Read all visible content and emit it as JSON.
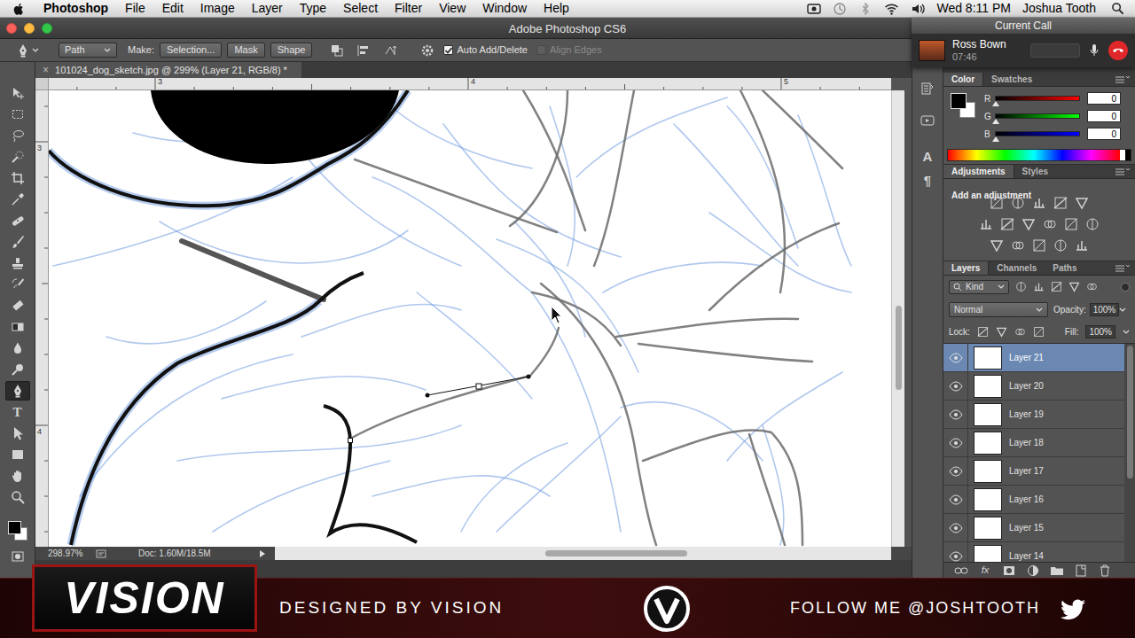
{
  "menubar": {
    "app": "Photoshop",
    "items": [
      "File",
      "Edit",
      "Image",
      "Layer",
      "Type",
      "Select",
      "Filter",
      "View",
      "Window",
      "Help"
    ],
    "clock": "Wed 8:11 PM",
    "user": "Joshua Tooth"
  },
  "window": {
    "title": "Adobe Photoshop CS6"
  },
  "call": {
    "title": "Current Call",
    "name": "Ross Bown",
    "time": "07:46"
  },
  "options_bar": {
    "mode": "Path",
    "make_label": "Make:",
    "buttons": [
      "Selection...",
      "Mask",
      "Shape"
    ],
    "checkboxes": [
      {
        "label": "Auto Add/Delete",
        "checked": true,
        "disabled": false
      },
      {
        "label": "Align Edges",
        "checked": false,
        "disabled": true
      }
    ]
  },
  "toolbox": {
    "tools": [
      {
        "kind": "move",
        "selected": false
      },
      {
        "kind": "marquee",
        "selected": false
      },
      {
        "kind": "lasso",
        "selected": false
      },
      {
        "kind": "quickselect",
        "selected": false
      },
      {
        "kind": "crop",
        "selected": false
      },
      {
        "kind": "eyedropper",
        "selected": false
      },
      {
        "kind": "healing",
        "selected": false
      },
      {
        "kind": "brush",
        "selected": false
      },
      {
        "kind": "stamp",
        "selected": false
      },
      {
        "kind": "history",
        "selected": false
      },
      {
        "kind": "eraser",
        "selected": false
      },
      {
        "kind": "gradient",
        "selected": false
      },
      {
        "kind": "blur",
        "selected": false
      },
      {
        "kind": "dodge",
        "selected": false
      },
      {
        "kind": "pen",
        "selected": true
      },
      {
        "kind": "type",
        "glyph": "T",
        "selected": false
      },
      {
        "kind": "pathselect",
        "selected": false
      },
      {
        "kind": "rectangle",
        "selected": false
      },
      {
        "kind": "hand",
        "selected": false
      },
      {
        "kind": "zoom",
        "selected": false
      }
    ],
    "foreground": "#000000",
    "background": "#ffffff"
  },
  "document": {
    "close": "×",
    "tab": "101024_dog_sketch.jpg @ 299% (Layer 21, RGB/8) *",
    "ruler_h": [
      "3",
      "4",
      "5"
    ],
    "ruler_v": [
      "3",
      "4"
    ],
    "zoom": "298.97%",
    "doc_size": "Doc: 1.60M/18.5M"
  },
  "icon_strip": [
    "A",
    "¶"
  ],
  "color_panel": {
    "tabs": [
      {
        "label": "Color",
        "selected": true
      },
      {
        "label": "Swatches",
        "selected": false
      }
    ],
    "channels": [
      {
        "name": "R",
        "value": "0",
        "level": 0,
        "color": "#ff0000"
      },
      {
        "name": "G",
        "value": "0",
        "level": 0,
        "color": "#00ff00"
      },
      {
        "name": "B",
        "value": "0",
        "level": 0,
        "color": "#0000ff"
      }
    ]
  },
  "adjustments_panel": {
    "tabs": [
      {
        "label": "Adjustments",
        "selected": true
      },
      {
        "label": "Styles",
        "selected": false
      }
    ],
    "hint": "Add an adjustment"
  },
  "layers_panel": {
    "tabs": [
      {
        "label": "Layers",
        "selected": true
      },
      {
        "label": "Channels",
        "selected": false
      },
      {
        "label": "Paths",
        "selected": false
      }
    ],
    "filter": "Kind",
    "blend_mode": "Normal",
    "opacity_label": "Opacity:",
    "opacity": "100%",
    "lock_label": "Lock:",
    "fill_label": "Fill:",
    "fill": "100%",
    "layers": [
      {
        "name": "Layer 21",
        "visible": true,
        "selected": true
      },
      {
        "name": "Layer 20",
        "visible": true,
        "selected": false
      },
      {
        "name": "Layer 19",
        "visible": true,
        "selected": false
      },
      {
        "name": "Layer 18",
        "visible": true,
        "selected": false
      },
      {
        "name": "Layer 17",
        "visible": true,
        "selected": false
      },
      {
        "name": "Layer 16",
        "visible": true,
        "selected": false
      },
      {
        "name": "Layer 15",
        "visible": true,
        "selected": false
      },
      {
        "name": "Layer 14",
        "visible": true,
        "selected": false
      }
    ],
    "fx": "fx"
  },
  "banner": {
    "logo": "VISION",
    "tagline": "DESIGNED BY VISION",
    "follow": "FOLLOW ME @JOSHTOOTH"
  }
}
